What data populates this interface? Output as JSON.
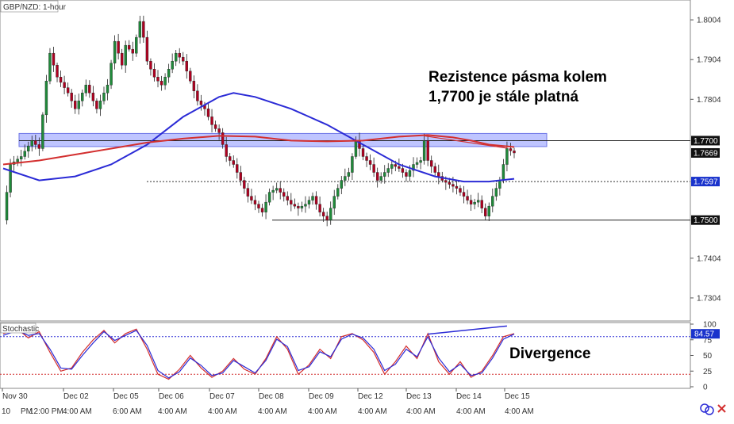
{
  "chart_data": [
    {
      "type": "candlestick",
      "title": "GBP/NZD: 1-hour",
      "ylim": [
        1.725,
        1.805
      ],
      "y_ticks": [
        {
          "value": 1.7304,
          "label": "1.7304"
        },
        {
          "value": 1.7404,
          "label": "1.7404"
        },
        {
          "value": 1.7804,
          "label": "1.7804"
        },
        {
          "value": 1.7904,
          "label": "1.7904"
        },
        {
          "value": 1.8004,
          "label": "1.8004"
        }
      ],
      "price_labels": [
        {
          "value": 1.77,
          "label": "1.7700",
          "style": "dark"
        },
        {
          "value": 1.7669,
          "label": "1.7669",
          "style": "dark"
        },
        {
          "value": 1.7597,
          "label": "1.7597",
          "style": "blue"
        },
        {
          "value": 1.75,
          "label": "1.7500",
          "style": "dark"
        }
      ],
      "x_date_labels": [
        "Nov 30",
        "Dec 02",
        "Dec 05",
        "Dec 06",
        "Dec 07",
        "Dec 08",
        "Dec 09",
        "Dec 12",
        "Dec 13",
        "Dec 14",
        "Dec 15"
      ],
      "x_time_labels": [
        "10",
        "PM",
        "12:00 PM",
        "4:00 AM",
        "6:00 AM",
        "4:00 AM",
        "4:00 AM",
        "4:00 AM",
        "4:00 AM",
        "4:00 AM",
        "4:00 AM",
        "4:00 AM",
        "4:00 AM"
      ],
      "resistance_zone": {
        "low": 1.7685,
        "high": 1.7718,
        "level": 1.77
      },
      "support_level": 1.75,
      "dotted_level": 1.7597,
      "price_path": [
        [
          0,
          1.75
        ],
        [
          2,
          1.764
        ],
        [
          5,
          1.766
        ],
        [
          8,
          1.77
        ],
        [
          10,
          1.768
        ],
        [
          12,
          1.785
        ],
        [
          13,
          1.792
        ],
        [
          15,
          1.786
        ],
        [
          18,
          1.782
        ],
        [
          20,
          1.778
        ],
        [
          23,
          1.784
        ],
        [
          26,
          1.778
        ],
        [
          29,
          1.784
        ],
        [
          31,
          1.795
        ],
        [
          33,
          1.789
        ],
        [
          34,
          1.794
        ],
        [
          36,
          1.792
        ],
        [
          38,
          1.8
        ],
        [
          39,
          1.796
        ],
        [
          40,
          1.79
        ],
        [
          42,
          1.786
        ],
        [
          44,
          1.784
        ],
        [
          46,
          1.788
        ],
        [
          48,
          1.792
        ],
        [
          50,
          1.79
        ],
        [
          52,
          1.785
        ],
        [
          54,
          1.78
        ],
        [
          56,
          1.778
        ],
        [
          58,
          1.774
        ],
        [
          60,
          1.772
        ],
        [
          62,
          1.766
        ],
        [
          64,
          1.764
        ],
        [
          66,
          1.76
        ],
        [
          68,
          1.756
        ],
        [
          70,
          1.754
        ],
        [
          72,
          1.752
        ],
        [
          74,
          1.757
        ],
        [
          76,
          1.758
        ],
        [
          78,
          1.756
        ],
        [
          80,
          1.754
        ],
        [
          82,
          1.753
        ],
        [
          84,
          1.754
        ],
        [
          86,
          1.756
        ],
        [
          88,
          1.752
        ],
        [
          90,
          1.75
        ],
        [
          92,
          1.756
        ],
        [
          94,
          1.76
        ],
        [
          96,
          1.762
        ],
        [
          98,
          1.77
        ],
        [
          100,
          1.766
        ],
        [
          102,
          1.764
        ],
        [
          104,
          1.76
        ],
        [
          106,
          1.762
        ],
        [
          108,
          1.764
        ],
        [
          110,
          1.763
        ],
        [
          112,
          1.761
        ],
        [
          114,
          1.764
        ],
        [
          116,
          1.765
        ],
        [
          117,
          1.77
        ],
        [
          118,
          1.765
        ],
        [
          120,
          1.762
        ],
        [
          122,
          1.76
        ],
        [
          124,
          1.759
        ],
        [
          126,
          1.758
        ],
        [
          128,
          1.756
        ],
        [
          130,
          1.754
        ],
        [
          132,
          1.755
        ],
        [
          134,
          1.751
        ],
        [
          136,
          1.756
        ],
        [
          138,
          1.76
        ],
        [
          140,
          1.768
        ],
        [
          142,
          1.7669
        ]
      ],
      "series": [
        {
          "name": "",
          "color": "#2b2bd6",
          "values": [
            [
              0,
              1.763
            ],
            [
              10,
              1.76
            ],
            [
              20,
              1.761
            ],
            [
              30,
              1.764
            ],
            [
              40,
              1.769
            ],
            [
              50,
              1.776
            ],
            [
              60,
              1.781
            ],
            [
              64,
              1.782
            ],
            [
              70,
              1.781
            ],
            [
              80,
              1.778
            ],
            [
              90,
              1.774
            ],
            [
              100,
              1.769
            ],
            [
              110,
              1.764
            ],
            [
              120,
              1.761
            ],
            [
              128,
              1.7597
            ],
            [
              135,
              1.7597
            ],
            [
              142,
              1.7604
            ]
          ]
        },
        {
          "name": "",
          "color": "#d32f2f",
          "values": [
            [
              0,
              1.764
            ],
            [
              10,
              1.765
            ],
            [
              20,
              1.7665
            ],
            [
              30,
              1.768
            ],
            [
              40,
              1.7695
            ],
            [
              50,
              1.7705
            ],
            [
              60,
              1.7712
            ],
            [
              70,
              1.771
            ],
            [
              80,
              1.77
            ],
            [
              90,
              1.7698
            ],
            [
              100,
              1.77
            ],
            [
              110,
              1.771
            ],
            [
              118,
              1.7714
            ],
            [
              125,
              1.7708
            ],
            [
              130,
              1.77
            ],
            [
              135,
              1.769
            ],
            [
              142,
              1.7684
            ]
          ]
        }
      ]
    },
    {
      "type": "line",
      "title": "Stochastic",
      "ylim": [
        0,
        100
      ],
      "y_ticks": [
        {
          "value": 100,
          "label": "100"
        },
        {
          "value": 75,
          "label": "75"
        },
        {
          "value": 50,
          "label": "50"
        },
        {
          "value": 25,
          "label": "25"
        },
        {
          "value": 0,
          "label": "0"
        }
      ],
      "current_value": {
        "value": 84.57,
        "label": "84.57"
      },
      "levels": [
        80,
        20
      ],
      "series": [
        {
          "name": "",
          "color": "#d32f2f",
          "values": [
            [
              0,
              85
            ],
            [
              4,
              92
            ],
            [
              7,
              78
            ],
            [
              10,
              88
            ],
            [
              13,
              55
            ],
            [
              16,
              25
            ],
            [
              19,
              30
            ],
            [
              22,
              55
            ],
            [
              25,
              75
            ],
            [
              28,
              90
            ],
            [
              31,
              70
            ],
            [
              34,
              85
            ],
            [
              37,
              92
            ],
            [
              40,
              60
            ],
            [
              43,
              20
            ],
            [
              46,
              12
            ],
            [
              49,
              28
            ],
            [
              52,
              50
            ],
            [
              55,
              30
            ],
            [
              58,
              15
            ],
            [
              61,
              25
            ],
            [
              64,
              45
            ],
            [
              67,
              28
            ],
            [
              70,
              20
            ],
            [
              73,
              45
            ],
            [
              76,
              80
            ],
            [
              79,
              60
            ],
            [
              82,
              20
            ],
            [
              85,
              35
            ],
            [
              88,
              60
            ],
            [
              91,
              45
            ],
            [
              94,
              80
            ],
            [
              97,
              85
            ],
            [
              100,
              75
            ],
            [
              103,
              55
            ],
            [
              106,
              20
            ],
            [
              109,
              40
            ],
            [
              112,
              65
            ],
            [
              115,
              45
            ],
            [
              118,
              85
            ],
            [
              121,
              40
            ],
            [
              124,
              20
            ],
            [
              127,
              40
            ],
            [
              130,
              15
            ],
            [
              133,
              25
            ],
            [
              136,
              50
            ],
            [
              139,
              80
            ],
            [
              142,
              85
            ]
          ]
        },
        {
          "name": "",
          "color": "#2b2bd6",
          "values": [
            [
              0,
              82
            ],
            [
              4,
              90
            ],
            [
              7,
              82
            ],
            [
              10,
              85
            ],
            [
              13,
              60
            ],
            [
              16,
              30
            ],
            [
              19,
              28
            ],
            [
              22,
              50
            ],
            [
              25,
              70
            ],
            [
              28,
              88
            ],
            [
              31,
              74
            ],
            [
              34,
              82
            ],
            [
              37,
              90
            ],
            [
              40,
              66
            ],
            [
              43,
              26
            ],
            [
              46,
              14
            ],
            [
              49,
              24
            ],
            [
              52,
              46
            ],
            [
              55,
              34
            ],
            [
              58,
              18
            ],
            [
              61,
              22
            ],
            [
              64,
              42
            ],
            [
              67,
              32
            ],
            [
              70,
              22
            ],
            [
              73,
              42
            ],
            [
              76,
              76
            ],
            [
              79,
              64
            ],
            [
              82,
              26
            ],
            [
              85,
              32
            ],
            [
              88,
              56
            ],
            [
              91,
              48
            ],
            [
              94,
              76
            ],
            [
              97,
              84
            ],
            [
              100,
              78
            ],
            [
              103,
              60
            ],
            [
              106,
              26
            ],
            [
              109,
              36
            ],
            [
              112,
              60
            ],
            [
              115,
              48
            ],
            [
              118,
              80
            ],
            [
              121,
              46
            ],
            [
              124,
              24
            ],
            [
              127,
              36
            ],
            [
              130,
              18
            ],
            [
              133,
              22
            ],
            [
              136,
              46
            ],
            [
              139,
              76
            ],
            [
              142,
              84
            ]
          ]
        }
      ]
    }
  ],
  "annotations": {
    "resistance_note_line1": "Rezistence pásma kolem",
    "resistance_note_line2": "1,7700 je stále platná",
    "divergence_note": "Divergence"
  },
  "colors": {
    "candle_up": "#1f8a3a",
    "candle_down": "#b00020",
    "zone_fill": "#a9b1ff",
    "zone_stroke": "#6c74e6",
    "price_tag_dark": "#111111",
    "price_tag_blue": "#1a33cc"
  }
}
